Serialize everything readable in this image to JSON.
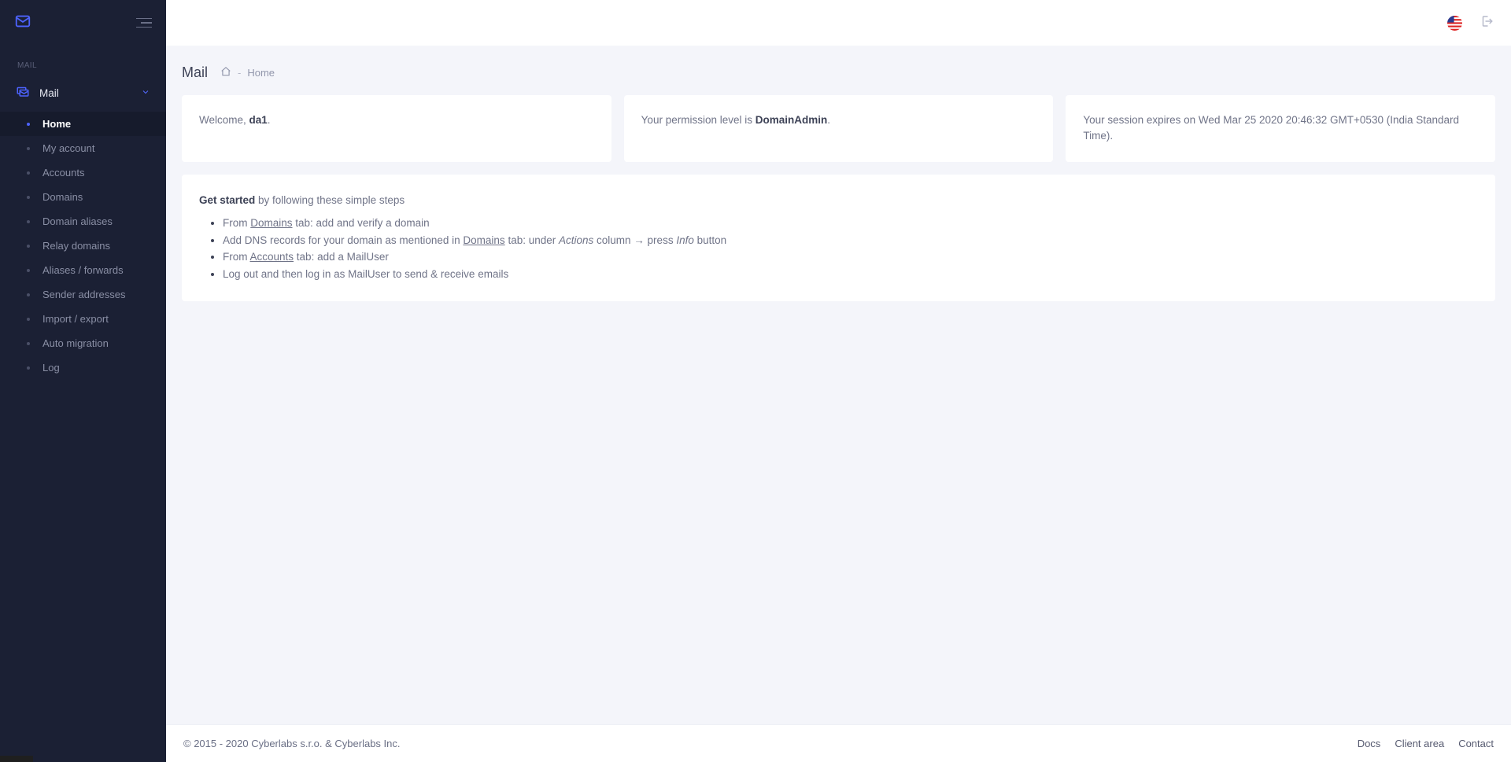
{
  "sidebar": {
    "section_label": "MAIL",
    "parent": {
      "label": "Mail"
    },
    "items": [
      {
        "label": "Home",
        "active": true
      },
      {
        "label": "My account"
      },
      {
        "label": "Accounts"
      },
      {
        "label": "Domains"
      },
      {
        "label": "Domain aliases"
      },
      {
        "label": "Relay domains"
      },
      {
        "label": "Aliases / forwards"
      },
      {
        "label": "Sender addresses"
      },
      {
        "label": "Import / export"
      },
      {
        "label": "Auto migration"
      },
      {
        "label": "Log"
      }
    ]
  },
  "page": {
    "title": "Mail",
    "breadcrumb_current": "Home"
  },
  "cards": {
    "welcome_prefix": "Welcome, ",
    "welcome_user": "da1",
    "welcome_suffix": ".",
    "permission_prefix": "Your permission level is ",
    "permission_level": "DomainAdmin",
    "permission_suffix": ".",
    "session_text": "Your session expires on Wed Mar 25 2020 20:46:32 GMT+0530 (India Standard Time)."
  },
  "steps": {
    "lead_strong": "Get started",
    "lead_rest": " by following these simple steps",
    "s1_a": "From ",
    "s1_link": "Domains",
    "s1_b": " tab: add and verify a domain",
    "s2_a": "Add DNS records for your domain as mentioned in ",
    "s2_link": "Domains",
    "s2_b": " tab: under ",
    "s2_em1": "Actions",
    "s2_c": " column → press ",
    "s2_em2": "Info",
    "s2_d": " button",
    "s3_a": "From ",
    "s3_link": "Accounts",
    "s3_b": " tab: add a MailUser",
    "s4": "Log out and then log in as MailUser to send & receive emails"
  },
  "footer": {
    "copyright": "© 2015 - 2020 Cyberlabs s.r.o. & Cyberlabs Inc.",
    "links": {
      "docs": "Docs",
      "client_area": "Client area",
      "contact": "Contact"
    }
  },
  "icons": {
    "locale": "en-US"
  }
}
